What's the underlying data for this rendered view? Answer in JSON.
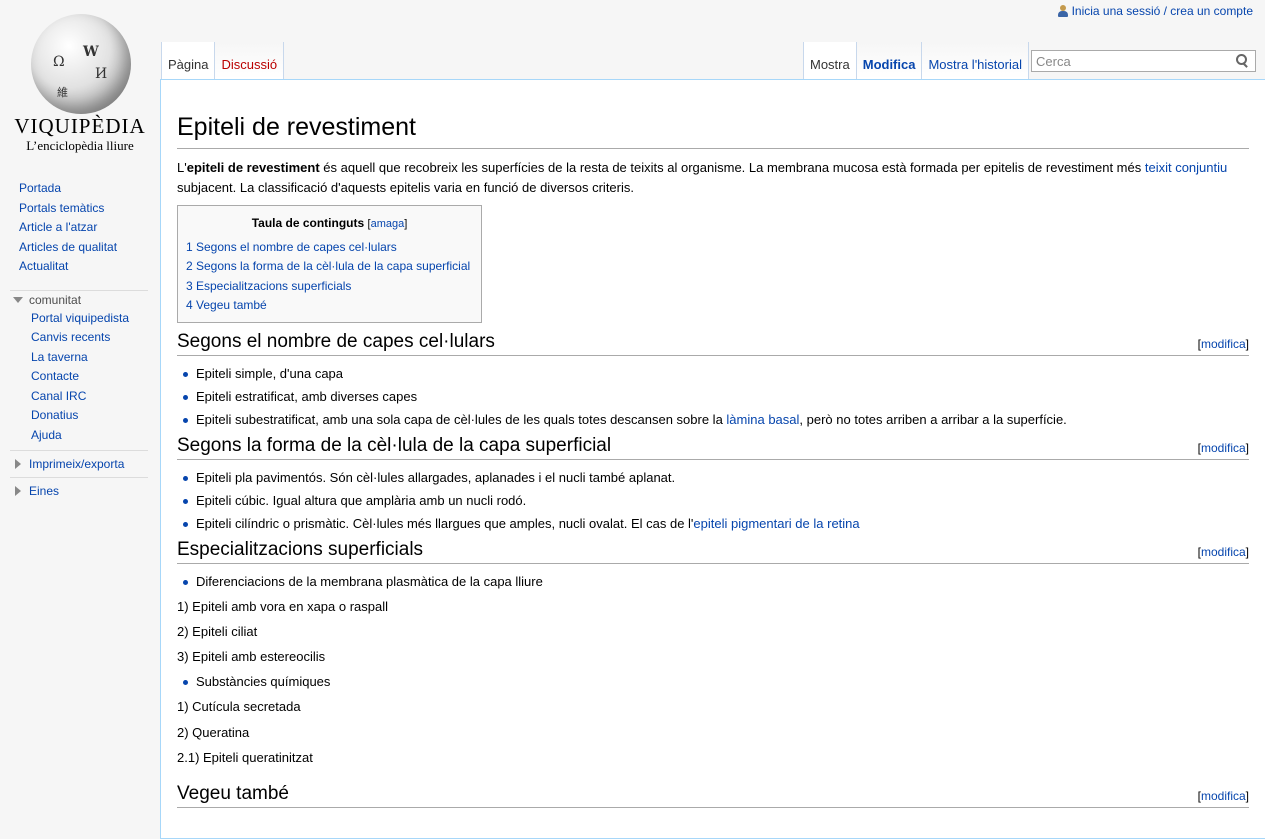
{
  "personal": {
    "login_label": "Inicia una sessió / crea un compte"
  },
  "logo": {
    "wordmark": "VIQUIPÈDIA",
    "tagline": "L’enciclopèdia lliure",
    "glyph_omega": "Ω",
    "glyph_w": "W",
    "glyph_i": "И",
    "glyph_chinese": "維"
  },
  "sidebar": {
    "navigation": [
      "Portada",
      "Portals temàtics",
      "Article a l'atzar",
      "Articles de qualitat",
      "Actualitat"
    ],
    "community_heading": "comunitat",
    "community": [
      "Portal viquipedista",
      "Canvis recents",
      "La taverna",
      "Contacte",
      "Canal IRC",
      "Donatius",
      "Ajuda"
    ],
    "print_heading": "Imprimeix/exporta",
    "tools_heading": "Eines"
  },
  "tabs": {
    "left": [
      "Pàgina",
      "Discussió"
    ],
    "right": [
      "Mostra",
      "Modifica",
      "Mostra l'historial"
    ]
  },
  "search": {
    "placeholder": "Cerca"
  },
  "article": {
    "title": "Epiteli de revestiment",
    "intro_pre": "L'",
    "intro_bold": "epiteli de revestiment",
    "intro_mid": " és aquell que recobreix les superfícies de la resta de teixits al organisme. La membrana mucosa està formada per epitelis de revestiment més ",
    "intro_link": "teixit conjuntiu",
    "intro_post": " subjacent. La classificació d'aquests epitelis varia en funció de diversos criteris.",
    "toc": {
      "title": "Taula de continguts",
      "toggle": "amaga",
      "items": [
        "1 Segons el nombre de capes cel·lulars",
        "2 Segons la forma de la cèl·lula de la capa superficial",
        "3 Especialitzacions superficials",
        "4 Vegeu també"
      ]
    },
    "edit_label": "modifica",
    "sections": {
      "s1": {
        "heading": "Segons el nombre de capes cel·lulars",
        "b1": "Epiteli simple, d'una capa",
        "b2": "Epiteli estratificat, amb diverses capes",
        "b3_pre": "Epiteli subestratificat, amb una sola capa de cèl·lules de les quals totes descansen sobre la ",
        "b3_link": "làmina basal",
        "b3_post": ", però no totes arriben a arribar a la superfície."
      },
      "s2": {
        "heading": "Segons la forma de la cèl·lula de la capa superficial",
        "b1": "Epiteli pla pavimentós. Són cèl·lules allargades, aplanades i el nucli també aplanat.",
        "b2": "Epiteli cúbic. Igual altura que amplària amb un nucli rodó.",
        "b3_pre": "Epiteli cilíndric o prismàtic. Cèl·lules més llargues que amples, nucli ovalat. El cas de l'",
        "b3_link": "epiteli pigmentari de la retina"
      },
      "s3": {
        "heading": "Especialitzacions superficials",
        "b1": "Diferenciacions de la membrana plasmàtica de la capa lliure",
        "l1": "1) Epiteli amb vora en xapa o raspall",
        "l2": "2) Epiteli ciliat",
        "l3": "3) Epiteli amb estereocilis",
        "b2": "Substàncies químiques",
        "l4": "1) Cutícula secretada",
        "l5": "2) Queratina",
        "l6": "2.1) Epiteli queratinitzat"
      },
      "s4": {
        "heading": "Vegeu també"
      }
    }
  }
}
